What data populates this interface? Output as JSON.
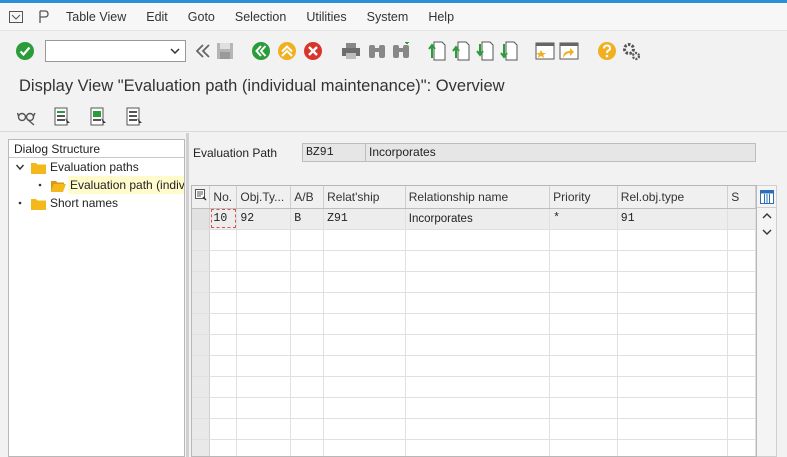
{
  "menu": {
    "items": [
      "Table View",
      "Edit",
      "Goto",
      "Selection",
      "Utilities",
      "System",
      "Help"
    ]
  },
  "toolbar": {
    "command_placeholder": "",
    "icons": [
      "enter-icon",
      "back-icon",
      "save-icon",
      "exit-icon",
      "cancel-icon",
      "print-icon",
      "find-icon",
      "find-next-icon",
      "first-page-icon",
      "previous-page-icon",
      "next-page-icon",
      "last-page-icon",
      "new-session-icon",
      "create-shortcut-icon",
      "help-icon",
      "customize-layout-icon"
    ]
  },
  "title": "Display View \"Evaluation path (individual maintenance)\": Overview",
  "tree": {
    "header": "Dialog Structure",
    "nodes": [
      {
        "label": "Evaluation paths"
      },
      {
        "label": "Evaluation path (individual maintenance)"
      },
      {
        "label": "Short names"
      }
    ]
  },
  "eval_path": {
    "label": "Evaluation Path",
    "value": "BZ91",
    "description": "Incorporates"
  },
  "table": {
    "columns": [
      "No.",
      "Obj.Ty...",
      "A/B",
      "Relat'ship",
      "Relationship name",
      "Priority",
      "Rel.obj.type",
      "S"
    ],
    "rows": [
      {
        "no": "10",
        "obj_type": "92",
        "ab": "B",
        "relship": "Z91",
        "rel_name": "Incorporates",
        "priority": "*",
        "rel_obj_type": "91",
        "s": ""
      }
    ]
  },
  "colors": {
    "accent_blue": "#2c8fd6",
    "ok_green": "#2a9d3a",
    "back_green": "#2a9d3a",
    "exit_yellow": "#f0b020",
    "cancel_red": "#d9342b",
    "folder_yellow": "#f3b81a",
    "help_yellow": "#f0b020"
  }
}
